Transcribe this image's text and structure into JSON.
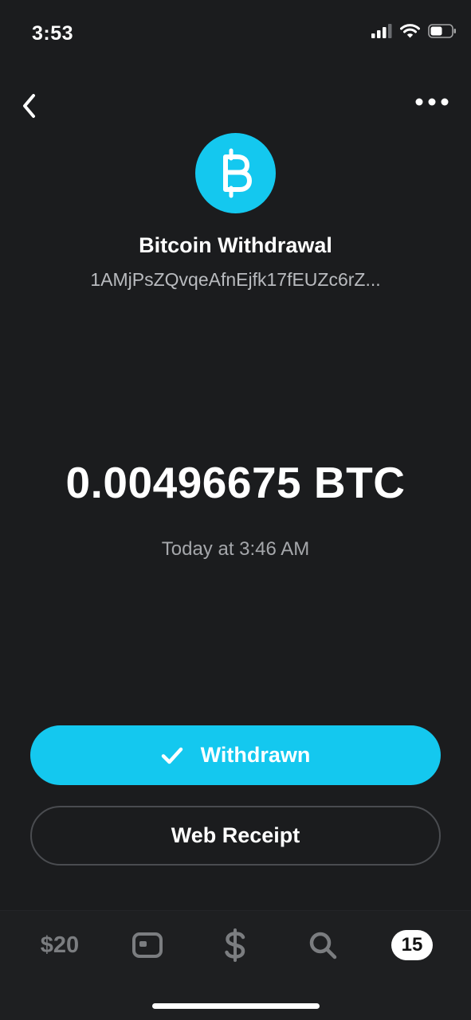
{
  "status_bar": {
    "time": "3:53"
  },
  "transaction": {
    "title": "Bitcoin Withdrawal",
    "address": "1AMjPsZQvqeAfnEjfk17fEUZc6rZ...",
    "amount": "0.00496675 BTC",
    "timestamp": "Today at 3:46 AM",
    "status_label": "Withdrawn",
    "receipt_label": "Web Receipt"
  },
  "tab_bar": {
    "balance": "$20",
    "activity_badge": "15",
    "icons": [
      "card-icon",
      "dollar-icon",
      "search-icon"
    ]
  },
  "colors": {
    "accent": "#14c8ef",
    "background": "#1b1c1e",
    "muted": "#a5a7ab"
  }
}
